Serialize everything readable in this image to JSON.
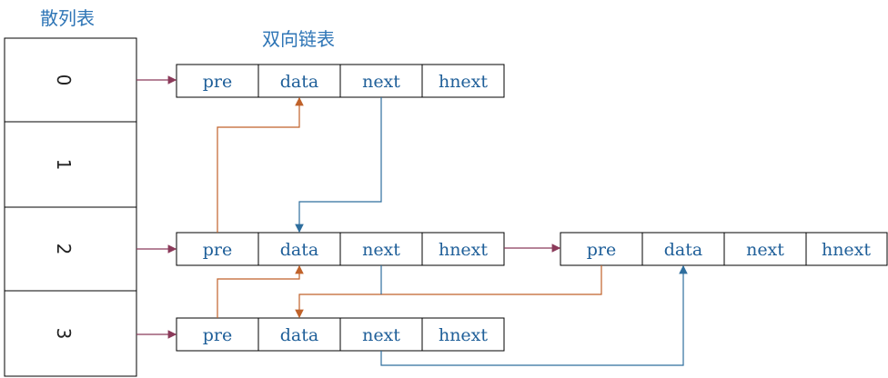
{
  "hash_table": {
    "title": "散列表",
    "slots": [
      "0",
      "1",
      "2",
      "3"
    ]
  },
  "linked_list": {
    "title": "双向链表",
    "fields": [
      "pre",
      "data",
      "next",
      "hnext"
    ]
  },
  "nodes": [
    {
      "id": "n0",
      "slot": "0"
    },
    {
      "id": "n2a",
      "slot": "2"
    },
    {
      "id": "n2b",
      "slot": "2"
    },
    {
      "id": "n3",
      "slot": "3"
    }
  ],
  "colors": {
    "hash_pointer": "#8b3a5a",
    "pre_pointer": "#c0622a",
    "next_pointer": "#2e6e9e",
    "label": "#2e75b6"
  }
}
